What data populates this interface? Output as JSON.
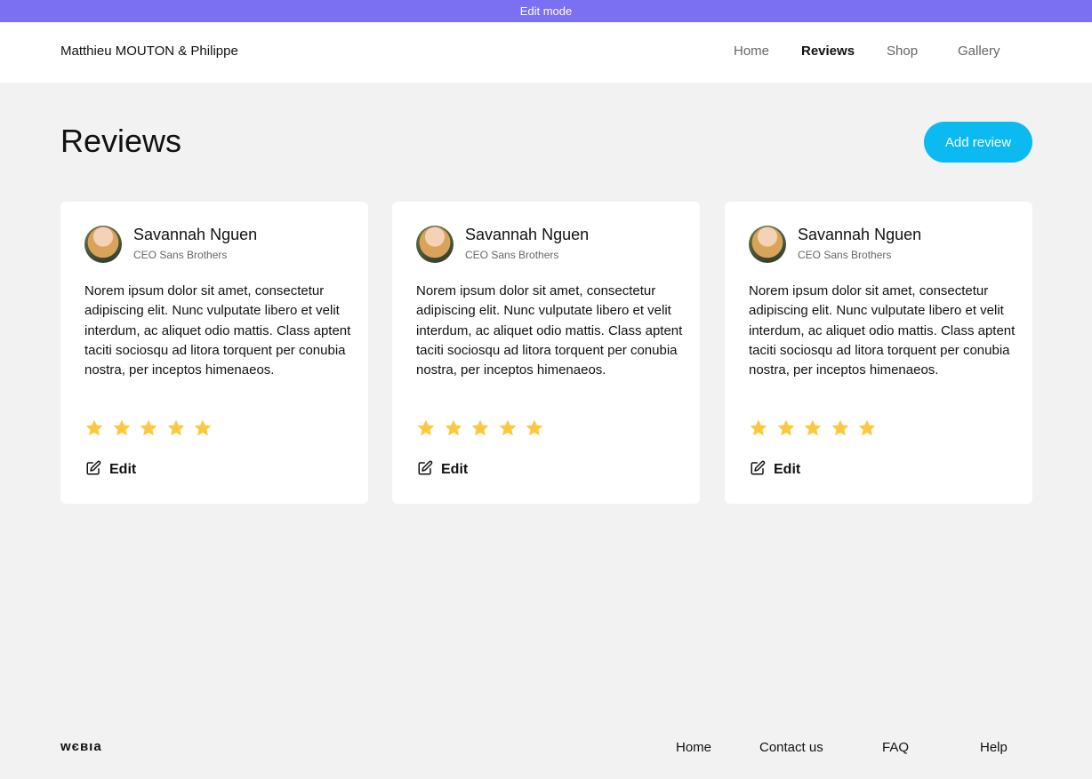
{
  "banner": {
    "label": "Edit mode"
  },
  "header": {
    "brand": "Matthieu MOUTON & Philippe",
    "nav": [
      {
        "label": "Home",
        "active": false
      },
      {
        "label": "Reviews",
        "active": true
      },
      {
        "label": "Shop",
        "active": false
      },
      {
        "label": "Gallery",
        "active": false
      }
    ]
  },
  "main": {
    "title": "Reviews",
    "add_button_label": "Add review",
    "reviews": [
      {
        "name": "Savannah Nguen",
        "role": "CEO Sans Brothers",
        "text": "Norem ipsum dolor sit amet, consectetur adipiscing elit. Nunc vulputate libero et velit interdum, ac aliquet odio mattis. Class aptent taciti sociosqu ad litora torquent per conubia nostra, per inceptos himenaeos.",
        "rating": 5,
        "edit_label": "Edit"
      },
      {
        "name": "Savannah Nguen",
        "role": "CEO Sans Brothers",
        "text": "Norem ipsum dolor sit amet, consectetur adipiscing elit. Nunc vulputate libero et velit interdum, ac aliquet odio mattis. Class aptent taciti sociosqu ad litora torquent per conubia nostra, per inceptos himenaeos.",
        "rating": 5,
        "edit_label": "Edit"
      },
      {
        "name": "Savannah Nguen",
        "role": "CEO Sans Brothers",
        "text": "Norem ipsum dolor sit amet, consectetur adipiscing elit. Nunc vulputate libero et velit interdum, ac aliquet odio mattis. Class aptent taciti sociosqu ad litora torquent per conubia nostra, per inceptos himenaeos.",
        "rating": 5,
        "edit_label": "Edit"
      }
    ]
  },
  "footer": {
    "logo": "WEBIA",
    "links": [
      "Home",
      "Contact us",
      "FAQ",
      "Help"
    ]
  },
  "colors": {
    "banner": "#7b6ff2",
    "accent": "#0abaf0",
    "star": "#fdc83f"
  }
}
